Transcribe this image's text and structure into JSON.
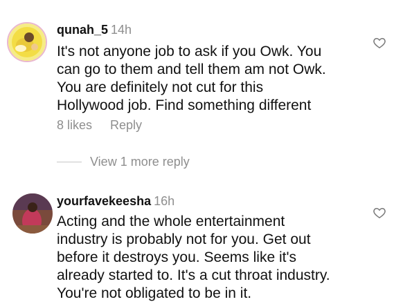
{
  "comments": [
    {
      "username": "qunah_5",
      "time": "14h",
      "text": "It's not anyone job to ask if you Owk. You\ncan go to them and tell them am not Owk.\nYou are definitely not cut for this\nHollywood job. Find something different",
      "likes": "8 likes",
      "reply_label": "Reply",
      "avatar_icon": "profile-avatar-yellow",
      "like_icon": "heart-outline-icon"
    },
    {
      "username": "yourfavekeesha",
      "time": "16h",
      "text": "Acting and the whole entertainment\nindustry is probably not for you. Get out\nbefore it destroys you. Seems like it's\nalready started to. It's a cut throat industry.\nYou're not obligated to be in it.",
      "avatar_icon": "profile-avatar-photo",
      "like_icon": "heart-outline-icon"
    }
  ],
  "view_more_replies": "View 1 more reply",
  "colors": {
    "text": "#111111",
    "muted": "#8e8e8e",
    "avatar_ring": "#e6a8c4"
  }
}
